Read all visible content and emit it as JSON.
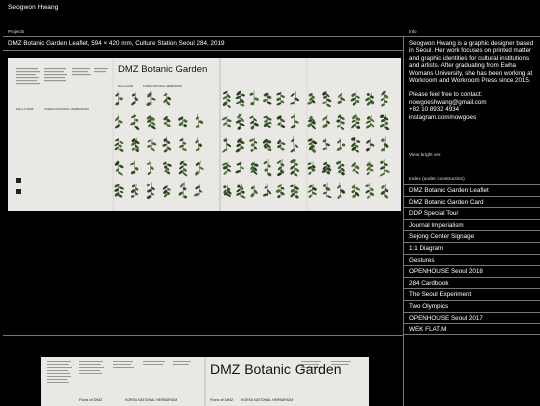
{
  "header": {
    "site_title": "Seogwon Hwang"
  },
  "labels": {
    "projects": "Projects",
    "info": "Info"
  },
  "project": {
    "caption": "DMZ Botanic Garden Leaflet, 594 × 420 mm, Culture Station Seoul 284, 2019",
    "poster_title": "DMZ Botanic Garden",
    "poster_sub_1": "Flora of DMZ",
    "poster_sub_2": "KOREA NATIONAL HERBARIUM"
  },
  "info": {
    "bio": "Seogwon Hwang is a graphic designer based in Seoul. Her work focuses on printed matter and graphic identities for cultural institutions and artists. After graduating from Ewha Womans University, she has been working at Workroom and Workroom Press since 2015.",
    "contact_intro": "Please feel free to contact:",
    "email": "nowgoeshwang@gmail.com",
    "phone": "+82 10 8932 4934",
    "instagram": "instagram.com/nowgoes",
    "view_bright": "View bright ver.",
    "index_header": "Index (under construction)",
    "index_items": [
      "DMZ Botanic Garden Leaflet",
      "DMZ Botanic Garden Card",
      "DDP Special Tour",
      "Journal Imperialism",
      "Sejong Center Signage",
      "1:1 Diagram",
      "Gestures",
      "OPENHOUSE Seoul 2018",
      "284 Cardbook",
      "The Seoul Experiment",
      "Two Olympics",
      "OPENHOUSE Seoul 2017",
      "WEK FLAT.M"
    ]
  }
}
